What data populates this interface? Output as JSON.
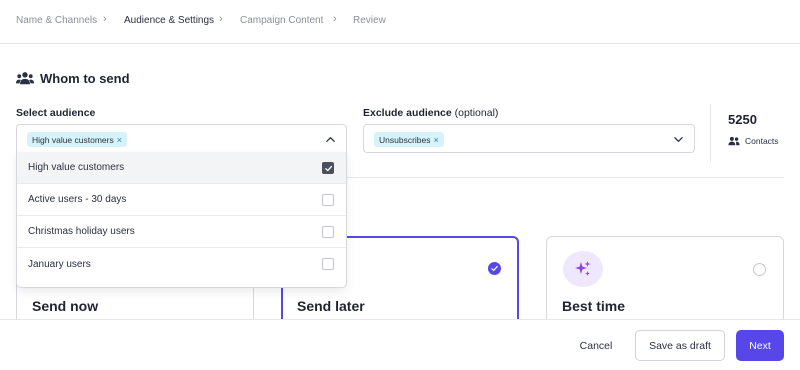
{
  "stepper": {
    "steps": [
      {
        "label": "Name & Channels",
        "state": "done"
      },
      {
        "label": "Audience & Settings",
        "state": "active"
      },
      {
        "label": "Campaign Content",
        "state": "todo"
      },
      {
        "label": "Review",
        "state": "todo"
      }
    ],
    "separator": "›"
  },
  "section": {
    "title": "Whom to send",
    "icon": "users-icon"
  },
  "select_audience": {
    "label": "Select audience",
    "selected_chip": "High value customers",
    "chip_remove": "×",
    "expanded": true,
    "options": [
      {
        "label": "High value customers",
        "checked": true
      },
      {
        "label": "Active users - 30 days",
        "checked": false
      },
      {
        "label": "Christmas holiday users",
        "checked": false
      },
      {
        "label": "January users",
        "checked": false
      }
    ]
  },
  "exclude_audience": {
    "label": "Exclude audience",
    "label_suffix": "(optional)",
    "selected_chip": "Unsubscribes",
    "chip_remove": "×",
    "expanded": false
  },
  "contacts": {
    "count": "5250",
    "label": "Contacts",
    "icon": "users-icon"
  },
  "send_options": [
    {
      "label": "Send now",
      "selected": false
    },
    {
      "label": "Send later",
      "selected": true
    },
    {
      "label": "Best time",
      "selected": false,
      "icon": "sparkle-icon"
    }
  ],
  "footer": {
    "cancel": "Cancel",
    "save_draft": "Save as draft",
    "next": "Next"
  },
  "colors": {
    "accent": "#5746e8",
    "chip_bg": "#d7f3fa",
    "sparkle_bg": "#efe7fb",
    "checkbox_checked": "#4a5060"
  }
}
